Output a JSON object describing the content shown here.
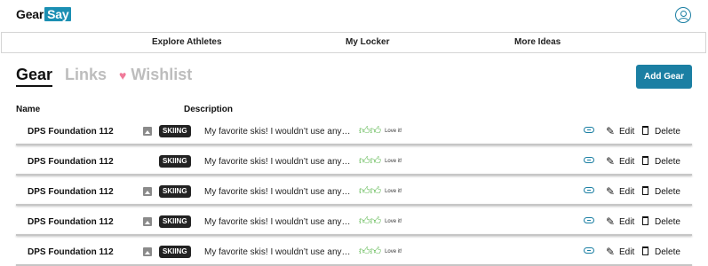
{
  "header": {
    "logo_gear": "Gear",
    "logo_say": "Say",
    "avatar_icon": "user-circle-icon"
  },
  "nav": {
    "items": [
      {
        "label": "Explore Athletes"
      },
      {
        "label": "My Locker"
      },
      {
        "label": "More Ideas"
      }
    ]
  },
  "tabs": {
    "gear": "Gear",
    "links": "Links",
    "wishlist": "Wishlist",
    "wishlist_icon": "heart-icon"
  },
  "toolbar": {
    "add_label": "Add Gear"
  },
  "table": {
    "columns": [
      "Name",
      "Description"
    ],
    "rows": [
      {
        "name": "DPS Foundation 112",
        "has_image": true,
        "tag": "SKIING",
        "description": "My favorite skis! I wouldn’t use any…",
        "reaction": "Love it!",
        "edit": "Edit",
        "delete": "Delete"
      },
      {
        "name": "DPS Foundation 112",
        "has_image": false,
        "tag": "SKIING",
        "description": "My favorite skis! I wouldn’t use any…",
        "reaction": "Love it!",
        "edit": "Edit",
        "delete": "Delete"
      },
      {
        "name": "DPS Foundation 112",
        "has_image": true,
        "tag": "SKIING",
        "description": "My favorite skis! I wouldn’t use any…",
        "reaction": "Love it!",
        "edit": "Edit",
        "delete": "Delete"
      },
      {
        "name": "DPS Foundation 112",
        "has_image": true,
        "tag": "SKIING",
        "description": "My favorite skis! I wouldn’t use any…",
        "reaction": "Love it!",
        "edit": "Edit",
        "delete": "Delete"
      },
      {
        "name": "DPS Foundation 112",
        "has_image": true,
        "tag": "SKIING",
        "description": "My favorite skis! I wouldn’t use any…",
        "reaction": "Love it!",
        "edit": "Edit",
        "delete": "Delete"
      }
    ]
  },
  "colors": {
    "brand": "#1b7fa3",
    "heart": "#f07a99",
    "thumbs": "#58b54a",
    "tag_bg": "#222222"
  }
}
